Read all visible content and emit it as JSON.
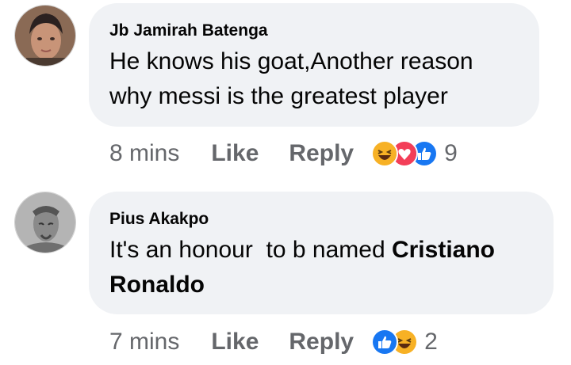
{
  "comments": [
    {
      "author": "Jb Jamirah Batenga",
      "text": "He knows his goat,Another reason why messi is the greatest player",
      "time": "8 mins",
      "like": "Like",
      "reply": "Reply",
      "reactions": [
        "haha",
        "love",
        "like"
      ],
      "reaction_count": "9"
    },
    {
      "author": "Pius Akakpo",
      "text_plain": "It's an honour  to b named ",
      "text_bold": "Cristiano Ronaldo",
      "time": "7 mins",
      "like": "Like",
      "reply": "Reply",
      "reactions": [
        "like",
        "haha"
      ],
      "reaction_count": "2"
    }
  ],
  "colors": {
    "bubble": "#f0f2f5",
    "meta": "#65676b",
    "like_blue": "#1877f2",
    "love_red": "#f33e58",
    "haha_yellow": "#f7b125"
  }
}
